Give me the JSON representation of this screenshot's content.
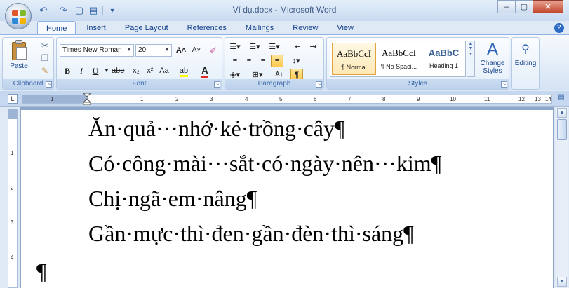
{
  "window": {
    "title": "Ví dụ.docx - Microsoft Word",
    "min_label": "▭",
    "restore_label": "▢",
    "close_label": "✕"
  },
  "qat": {
    "undo": "↶",
    "redo": "↷",
    "save": "▢",
    "doc": "▤",
    "more": "▾"
  },
  "tabs": [
    {
      "label": "Home"
    },
    {
      "label": "Insert"
    },
    {
      "label": "Page Layout"
    },
    {
      "label": "References"
    },
    {
      "label": "Mailings"
    },
    {
      "label": "Review"
    },
    {
      "label": "View"
    }
  ],
  "help": "?",
  "clipboard": {
    "group_label": "Clipboard",
    "paste_label": "Paste",
    "cut": "✂",
    "copy": "❐",
    "format_painter": "✎"
  },
  "font": {
    "group_label": "Font",
    "font_name": "Times New Roman",
    "font_size": "20",
    "grow": "A˄",
    "shrink": "A˅",
    "clear": "✐",
    "bold": "B",
    "italic": "I",
    "underline": "U",
    "strike": "abe",
    "subscript": "x₂",
    "superscript": "x²",
    "change_case": "Aa",
    "highlight": "ab",
    "font_color": "A",
    "highlight_color": "#ffff00",
    "font_color_value": "#e02b20"
  },
  "paragraph": {
    "group_label": "Paragraph",
    "show_marks": "¶",
    "sort": "A↓"
  },
  "styles": {
    "group_label": "Styles",
    "items": [
      {
        "sample": "AaBbCcI",
        "name": "¶ Normal"
      },
      {
        "sample": "AaBbCcI",
        "name": "¶ No Spaci..."
      },
      {
        "sample": "AaBbC",
        "name": "Heading 1"
      }
    ],
    "change_styles": "Change Styles",
    "editing": "Editing"
  },
  "ruler": {
    "corner": "L",
    "numbers": [
      "1",
      "2",
      "3",
      "4",
      "5",
      "6",
      "7",
      "8",
      "9",
      "10",
      "11",
      "12",
      "13",
      "14"
    ],
    "neg": "1"
  },
  "vruler": {
    "numbers": [
      "1",
      "2",
      "3",
      "4"
    ]
  },
  "document": {
    "lines": [
      "Ăn·quả···nhớ·kẻ·trồng·cây¶",
      "Có·công·mài···sắt·có·ngày·nên···kim¶",
      "Chị·ngã·em·nâng¶",
      "Gần·mực·thì·đen·gần·đèn·thì·sáng¶"
    ],
    "empty_line": "¶"
  }
}
